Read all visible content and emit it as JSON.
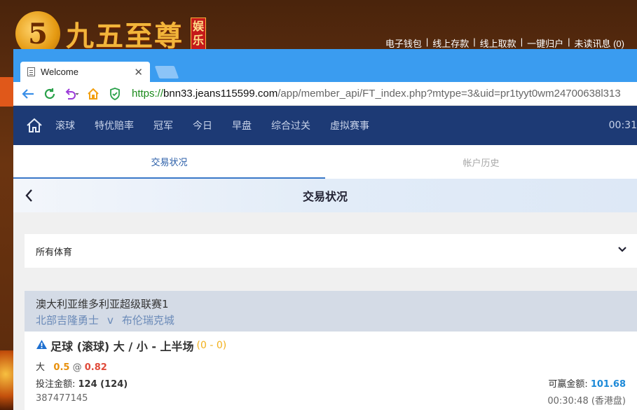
{
  "background_site": {
    "logo_text": "九五至尊",
    "logo_digit": "5",
    "logo_side_text": "娱乐",
    "links": [
      "电子钱包",
      "线上存款",
      "线上取款",
      "一键归户",
      "未读讯息 (0)"
    ]
  },
  "browser": {
    "tab_title": "Welcome",
    "url_proto": "https://",
    "url_host": "bnn33.jeans115599.com",
    "url_path": "/app/member_api/FT_index.php?mtype=3&uid=pr1tyyt0wm24700638l313"
  },
  "topnav": {
    "items": [
      "滚球",
      "特优赔率",
      "冠军",
      "今日",
      "早盘",
      "综合过关",
      "虚拟赛事"
    ],
    "clock": "00:31"
  },
  "subtabs": [
    "交易状况",
    "帐户历史"
  ],
  "page_title": "交易状况",
  "sport_filter": "所有体育",
  "bet": {
    "league": "澳大利亚维多利亚超级联赛1",
    "home": "北部吉隆勇士",
    "vs": "v",
    "away": "布伦瑞克城",
    "type": "足球 (滚球) 大 / 小 - 上半场",
    "score": "(0 - 0)",
    "selection": "大",
    "line": "0.5",
    "at": "@",
    "odds": "0.82",
    "stake_label": "投注金额: ",
    "stake_value": "124 (124)",
    "win_label": "可赢金额: ",
    "win_value": "101.68",
    "ticket_id": "387477145",
    "time": "00:30:48 (香港盘)"
  }
}
